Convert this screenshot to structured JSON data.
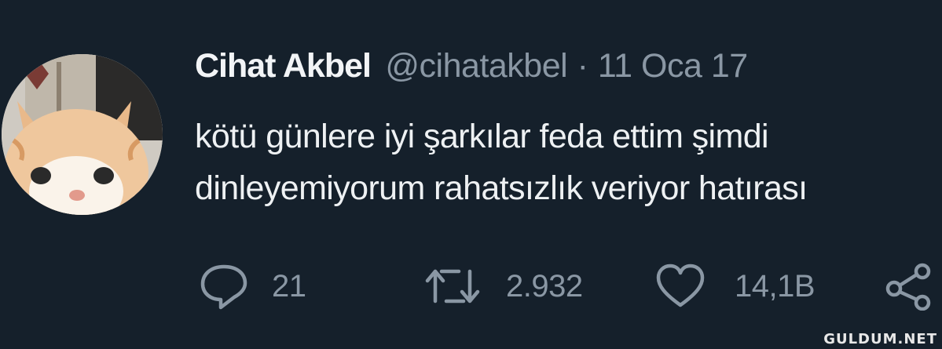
{
  "tweet": {
    "display_name": "Cihat Akbel",
    "handle": "@cihatakbel",
    "separator": "·",
    "date": "11 Oca 17",
    "text_line1": "kötü günlere iyi şarkılar feda ettim şimdi",
    "text_line2": "dinleyemiyorum rahatsızlık veriyor hatırası",
    "avatar_icon": "cat-avatar"
  },
  "actions": {
    "reply": {
      "icon": "reply-icon",
      "count": "21"
    },
    "retweet": {
      "icon": "retweet-icon",
      "count": "2.932"
    },
    "like": {
      "icon": "heart-icon",
      "count": "14,1B"
    },
    "share": {
      "icon": "share-icon"
    }
  },
  "watermark": "GULDUM.NET",
  "colors": {
    "background": "#15202b",
    "primary_text": "#eef1f3",
    "secondary_text": "#8a97a4"
  }
}
